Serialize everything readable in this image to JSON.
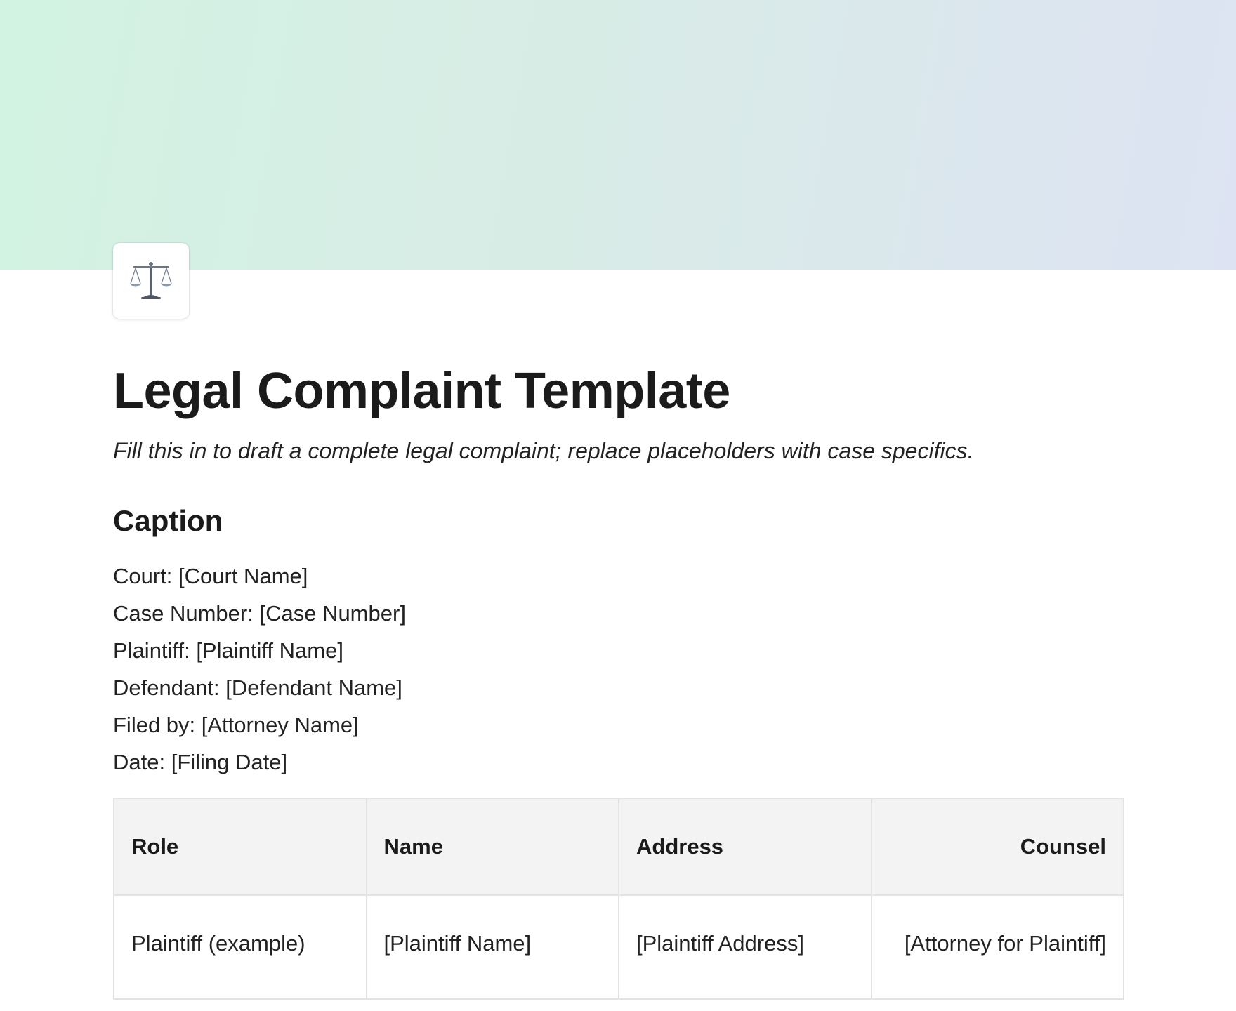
{
  "page": {
    "icon": "balance-scale-icon",
    "title": "Legal Complaint Template",
    "subtitle": "Fill this in to draft a complete legal complaint; replace placeholders with case specifics."
  },
  "caption": {
    "heading": "Caption",
    "lines": [
      "Court: [Court Name]",
      "Case Number: [Case Number]",
      "Plaintiff: [Plaintiff Name]",
      "Defendant: [Defendant Name]",
      "Filed by: [Attorney Name]",
      "Date: [Filing Date]"
    ]
  },
  "table": {
    "headers": [
      "Role",
      "Name",
      "Address",
      "Counsel"
    ],
    "rows": [
      [
        "Plaintiff (example)",
        "[Plaintiff Name]",
        "[Plaintiff Address]",
        "[Attorney for Plaintiff]"
      ]
    ]
  },
  "colors": {
    "cover_start": "#d2f3e2",
    "cover_end": "#dde3f3",
    "header_bg": "#f3f3f3",
    "border": "#e3e3e3"
  }
}
